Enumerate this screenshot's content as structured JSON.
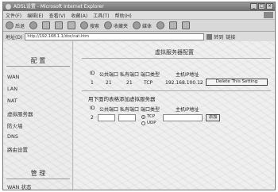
{
  "window": {
    "title": "ADSL设置 - Microsoft Internet Explorer",
    "min_label": "_",
    "max_label": "□",
    "close_label": "×"
  },
  "menu": {
    "items": [
      "文件(F)",
      "编辑(E)",
      "查看(V)",
      "收藏(A)",
      "工具(T)",
      "帮助(H)"
    ]
  },
  "toolbar": {
    "back_label": "后退",
    "search_label": "搜索",
    "favorites_label": "收藏夹",
    "media_label": "媒体"
  },
  "address": {
    "label": "地址(D)",
    "url": "http://192.168.1.1/doc/nat.htm",
    "go_label": "转到",
    "links_label": "链接"
  },
  "sidebar": {
    "config_title": "配 置",
    "items": [
      "WAN",
      "LAN",
      "NAT",
      "虚拟服务器",
      "防火墙",
      "DNS",
      "路由设置"
    ],
    "active_index": 3,
    "manage_title": "管 理",
    "bottom_item": "WAN 状态"
  },
  "content": {
    "title": "虚拟服务器配置",
    "table_headers": {
      "id": "ID",
      "public_port": "公共端口",
      "private_port": "私有端口",
      "port_type": "端口类型",
      "host_ip": "主机IP地址"
    },
    "rows": [
      {
        "id": "1",
        "public_port": "21",
        "private_port": "21",
        "port_type": "TCP",
        "host_ip": "192.168.100.12"
      }
    ],
    "delete_button": "Delete This Setting",
    "add_section_title": "用下面的表格添加虚拟服务器",
    "new_id": "2",
    "protocol_options": [
      "TCP",
      "UDP"
    ],
    "protocol_selected": "TCP",
    "add_button": "添加"
  }
}
